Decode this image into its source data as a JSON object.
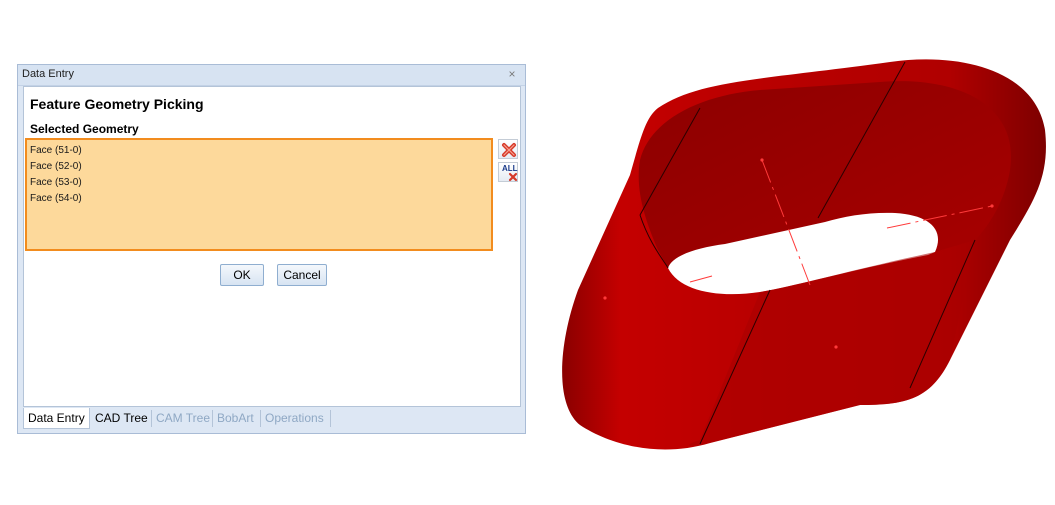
{
  "dialog": {
    "title": "Data Entry",
    "close_glyph": "×",
    "heading": "Feature Geometry Picking",
    "subheading": "Selected Geometry",
    "items": [
      "Face (51-0)",
      "Face (52-0)",
      "Face (53-0)",
      "Face (54-0)"
    ],
    "remove_icon": "red-x-icon",
    "remove_all_label": "ALL",
    "ok_label": "OK",
    "cancel_label": "Cancel"
  },
  "tabs": [
    {
      "label": "Data Entry",
      "state": "active"
    },
    {
      "label": "CAD Tree",
      "state": "normal"
    },
    {
      "label": "CAM Tree",
      "state": "disabled"
    },
    {
      "label": "BobArt",
      "state": "disabled"
    },
    {
      "label": "Operations",
      "state": "disabled"
    }
  ],
  "colors": {
    "accent_orange": "#f28c1e",
    "list_fill": "#fdd99b",
    "shape_red": "#c80000",
    "disabled_tab_text": "#8fa8c4"
  },
  "viewport": {
    "object": "extruded-stadium-ring",
    "color": "#c80000"
  }
}
